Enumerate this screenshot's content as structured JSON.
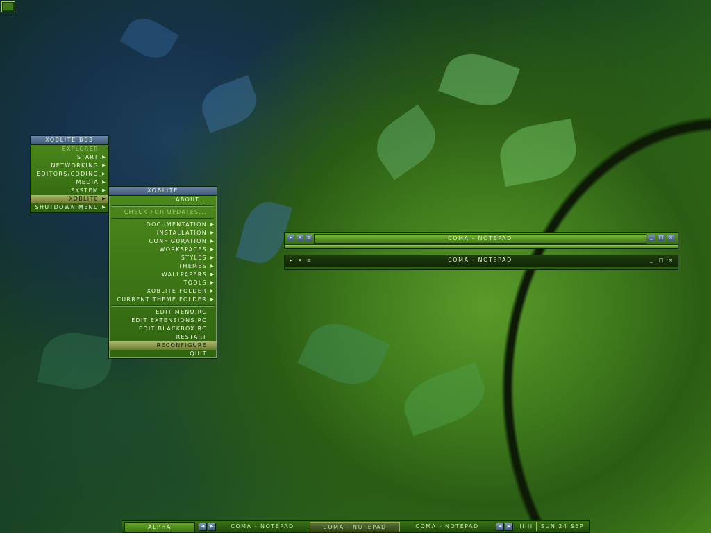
{
  "desktop": {
    "corner_icon": "window-icon"
  },
  "main_menu": {
    "title": "XOBLITE BB3",
    "items": [
      {
        "label": "EXPLORER",
        "submenu": false,
        "highlighted": false
      },
      {
        "label": "START",
        "submenu": true,
        "highlighted": false
      },
      {
        "label": "NETWORKING",
        "submenu": true,
        "highlighted": false
      },
      {
        "label": "EDITORS/CODING",
        "submenu": true,
        "highlighted": false
      },
      {
        "label": "MEDIA",
        "submenu": true,
        "highlighted": false
      },
      {
        "label": "SYSTEM",
        "submenu": true,
        "highlighted": false
      },
      {
        "label": "XOBLITE",
        "submenu": true,
        "highlighted": true
      },
      {
        "label": "SHUTDOWN MENU",
        "submenu": true,
        "highlighted": false
      }
    ]
  },
  "xoblite_menu": {
    "title": "XOBLITE",
    "items": {
      "about": "ABOUT...",
      "check_updates": "CHECK FOR UPDATES...",
      "documentation": "DOCUMENTATION",
      "installation": "INSTALLATION",
      "configuration": "CONFIGURATION",
      "workspaces": "WORKSPACES",
      "styles": "STYLES",
      "themes": "THEMES",
      "wallpapers": "WALLPAPERS",
      "tools": "TOOLS",
      "xoblite_folder": "XOBLITE FOLDER",
      "current_theme_folder": "CURRENT THEME FOLDER",
      "edit_menu": "EDIT MENU.RC",
      "edit_extensions": "EDIT EXTENSIONS.RC",
      "edit_blackbox": "EDIT BLACKBOX.RC",
      "restart": "RESTART",
      "reconfigure": "RECONFIGURE",
      "quit": "QUIT"
    }
  },
  "window1": {
    "title": "COMA - NOTEPAD",
    "buttons": [
      "pin-icon",
      "shade-icon",
      "stick-icon",
      "minimize-icon",
      "maximize-icon",
      "close-icon"
    ]
  },
  "window2": {
    "title": "COMA - NOTEPAD",
    "buttons": [
      "pin-icon",
      "shade-icon",
      "stick-icon",
      "minimize-icon",
      "maximize-icon",
      "close-icon"
    ]
  },
  "taskbar": {
    "workspace": "ALPHA",
    "tasks": [
      "COMA - NOTEPAD",
      "COMA - NOTEPAD",
      "COMA - NOTEPAD"
    ],
    "active_task_index": 1,
    "tray": "IIIII",
    "clock": "SUN 24 SEP"
  },
  "colors": {
    "menu_green": "#3f7b18",
    "title_blue": "#4f6a8a",
    "highlight": "#9aa85a"
  }
}
